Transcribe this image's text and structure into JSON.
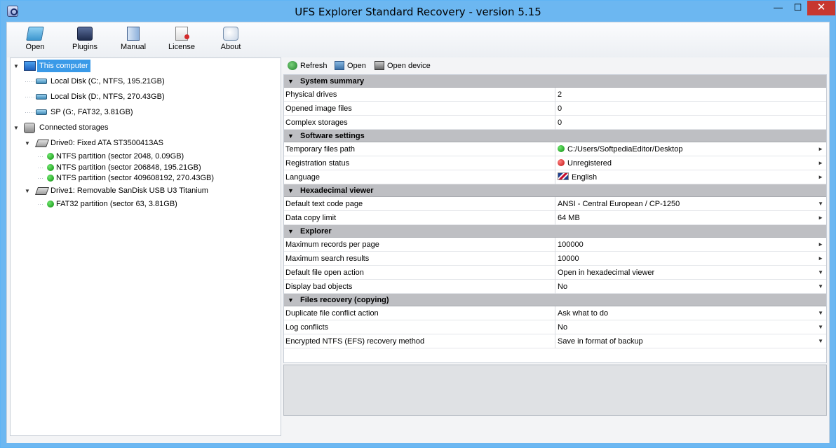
{
  "window": {
    "title": "UFS Explorer Standard Recovery - version 5.15",
    "controls": {
      "minimize": "—",
      "maximize": "☐",
      "close": "✕"
    }
  },
  "toolbar": {
    "buttons": [
      {
        "label": "Open",
        "icon": "open-folder-icon"
      },
      {
        "label": "Plugins",
        "icon": "plugins-icon"
      },
      {
        "label": "Manual",
        "icon": "manual-book-icon"
      },
      {
        "label": "License",
        "icon": "license-certificate-icon"
      },
      {
        "label": "About",
        "icon": "about-info-icon"
      }
    ]
  },
  "tree": {
    "root": {
      "label": "This computer",
      "icon": "computer-icon",
      "selected": true
    },
    "disks": [
      {
        "label": "Local Disk (C:, NTFS, 195.21GB)",
        "icon": "disk-icon"
      },
      {
        "label": "Local Disk (D:, NTFS, 270.43GB)",
        "icon": "disk-icon"
      },
      {
        "label": "SP (G:, FAT32, 3.81GB)",
        "icon": "disk-icon"
      }
    ],
    "storages": {
      "label": "Connected storages",
      "icon": "storages-icon"
    },
    "drive0": {
      "label": "Drive0: Fixed ATA ST3500413AS",
      "icon": "hard-drive-icon",
      "partitions": [
        "NTFS partition (sector 2048, 0.09GB)",
        "NTFS partition (sector 206848, 195.21GB)",
        "NTFS partition (sector 409608192, 270.43GB)"
      ]
    },
    "drive1": {
      "label": "Drive1: Removable SanDisk USB U3 Titanium",
      "icon": "hard-drive-icon",
      "partitions": [
        "FAT32 partition (sector 63, 3.81GB)"
      ]
    }
  },
  "actions": {
    "refresh": "Refresh",
    "open": "Open",
    "open_device": "Open device"
  },
  "grid": {
    "system_summary": {
      "title": "System summary",
      "rows": [
        {
          "name": "Physical drives",
          "value": "2"
        },
        {
          "name": "Opened image files",
          "value": "0"
        },
        {
          "name": "Complex storages",
          "value": "0"
        }
      ]
    },
    "software_settings": {
      "title": "Software settings",
      "rows": [
        {
          "name": "Temporary files path",
          "value": "C:/Users/SoftpediaEditor/Desktop",
          "status": "green",
          "arrow": "►"
        },
        {
          "name": "Registration status",
          "value": "Unregistered",
          "status": "red",
          "arrow": "►"
        },
        {
          "name": "Language",
          "value": "English",
          "status": "flag",
          "arrow": "►"
        }
      ]
    },
    "hex_viewer": {
      "title": "Hexadecimal viewer",
      "rows": [
        {
          "name": "Default text code page",
          "value": "ANSI - Central European / CP-1250",
          "arrow": "▼"
        },
        {
          "name": "Data copy limit",
          "value": "64 MB",
          "arrow": "►"
        }
      ]
    },
    "explorer": {
      "title": "Explorer",
      "rows": [
        {
          "name": "Maximum records per page",
          "value": "100000",
          "arrow": "►"
        },
        {
          "name": "Maximum search results",
          "value": "10000",
          "arrow": "►"
        },
        {
          "name": "Default file open action",
          "value": "Open in hexadecimal viewer",
          "arrow": "▼"
        },
        {
          "name": "Display bad objects",
          "value": "No",
          "arrow": "▼"
        }
      ]
    },
    "files_recovery": {
      "title": "Files recovery (copying)",
      "rows": [
        {
          "name": "Duplicate file conflict action",
          "value": "Ask what to do",
          "arrow": "▼"
        },
        {
          "name": "Log conflicts",
          "value": "No",
          "arrow": "▼"
        },
        {
          "name": "Encrypted NTFS (EFS) recovery method",
          "value": "Save in format of backup",
          "arrow": "▼"
        }
      ]
    },
    "category_marker": "▼"
  },
  "colors": {
    "titlebar": "#6cb7f1",
    "selection": "#3a9ae8",
    "category_header": "#bebfc3",
    "close_button": "#c7372f"
  }
}
